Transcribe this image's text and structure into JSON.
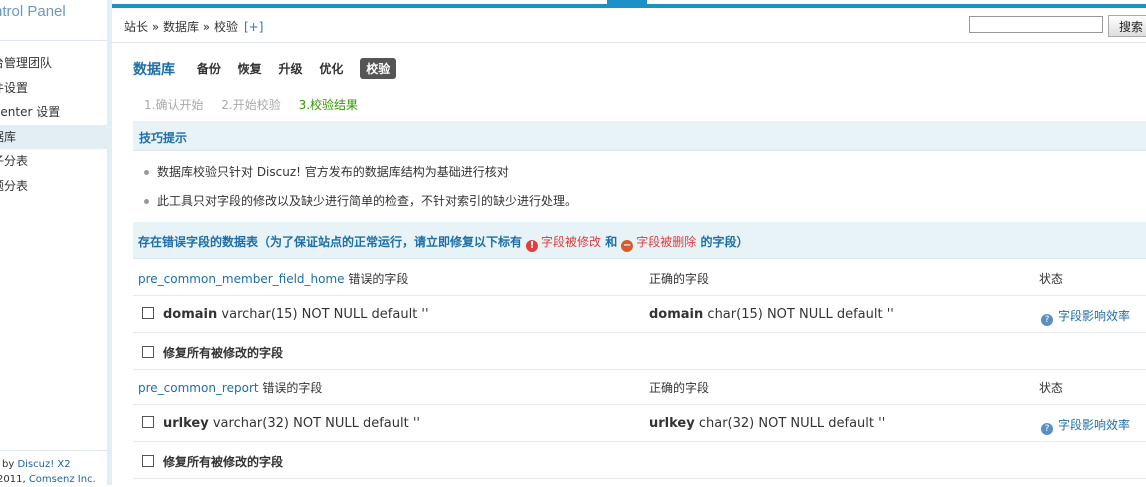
{
  "sidebar": {
    "brand": "ntrol Panel",
    "items": [
      {
        "label": "台管理团队",
        "active": false
      },
      {
        "label": "件设置",
        "active": false
      },
      {
        "label": "Center 设置",
        "active": false
      },
      {
        "label": "据库",
        "active": true
      },
      {
        "label": "子分表",
        "active": false
      },
      {
        "label": "题分表",
        "active": false
      }
    ],
    "footer": {
      "by": "by",
      "product": "Discuz! X2",
      "copyright": "2011,",
      "company": "Comsenz Inc."
    }
  },
  "header": {
    "breadcrumb": "站长 » 数据库 » 校验",
    "plus": "[+]",
    "search_value": "",
    "search_button": "搜索"
  },
  "page": {
    "title": "数据库",
    "tabs": [
      {
        "label": "备份",
        "current": false
      },
      {
        "label": "恢复",
        "current": false
      },
      {
        "label": "升级",
        "current": false
      },
      {
        "label": "优化",
        "current": false
      },
      {
        "label": "校验",
        "current": true
      }
    ],
    "steps": [
      "1.确认开始",
      "2.开始校验",
      "3.校验结果"
    ],
    "tips_title": "技巧提示",
    "tips": [
      "数据库校验只针对 Discuz! 官方发布的数据库结构为基础进行核对",
      "此工具只对字段的修改以及缺少进行简单的检查，不针对索引的缺少进行处理。"
    ],
    "error_head": {
      "prefix": "存在错误字段的数据表（为了保证站点的正常运行，请立即修复以下标有",
      "modified": "字段被修改",
      "and": "和",
      "deleted": "字段被删除",
      "suffix": "的字段）"
    },
    "col_wrong_suffix": "错误的字段",
    "col_correct": "正确的字段",
    "col_status": "状态",
    "fix_label": "修复所有被修改的字段",
    "effect_label": "字段影响效率",
    "tables": [
      {
        "name": "pre_common_member_field_home",
        "field": "domain",
        "wrong_def": "varchar(15) NOT NULL default ''",
        "correct_def": "char(15) NOT NULL default ''"
      },
      {
        "name": "pre_common_report",
        "field": "urlkey",
        "wrong_def": "varchar(32) NOT NULL default ''",
        "correct_def": "char(32) NOT NULL default ''"
      }
    ]
  }
}
